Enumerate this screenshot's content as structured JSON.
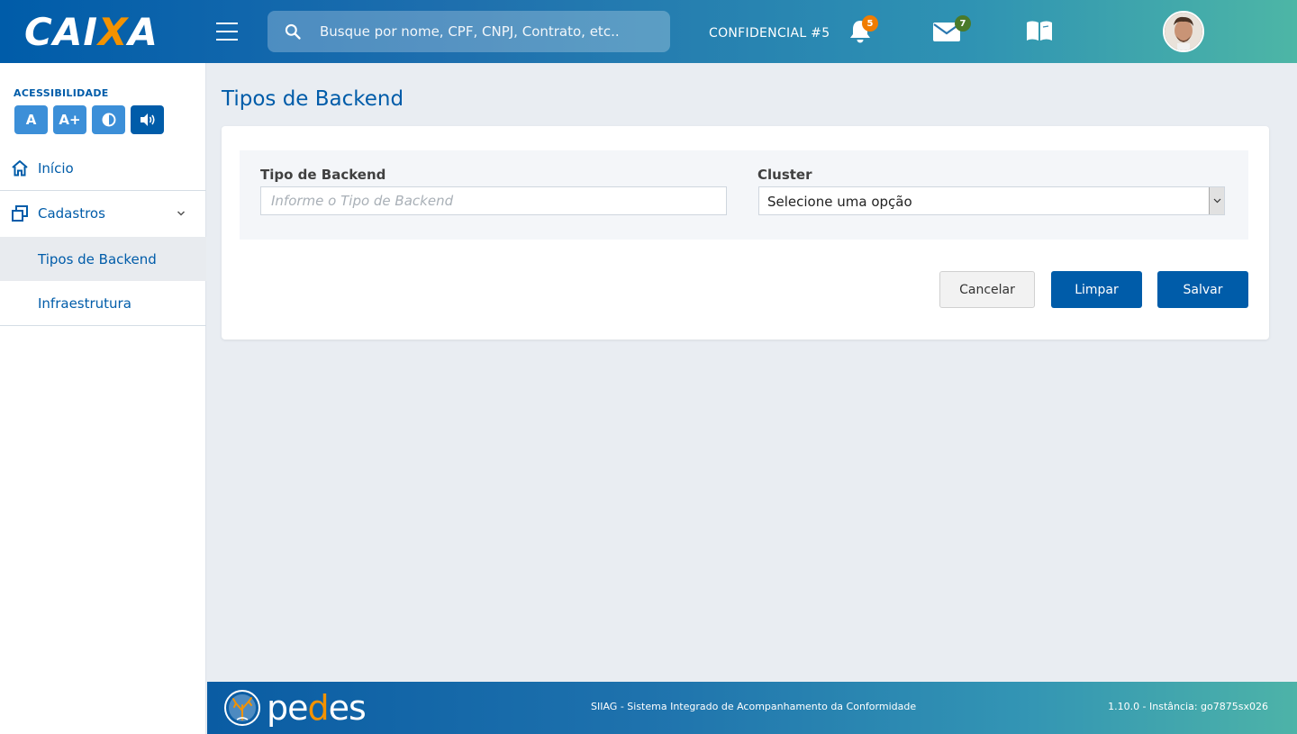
{
  "header": {
    "logo_prefix": "CAI",
    "logo_x": "X",
    "logo_suffix": "A",
    "search_placeholder": "Busque por nome, CPF, CNPJ, Contrato, etc..",
    "confidential_label": "CONFIDENCIAL #5",
    "notifications_count": "5",
    "messages_count": "7",
    "notification_badge_color": "#f07c00",
    "message_badge_color": "#4a7a2a",
    "icons": [
      "menu-icon",
      "search-icon",
      "bell-icon",
      "envelope-icon",
      "book-icon",
      "avatar"
    ]
  },
  "sidebar": {
    "accessibility_title": "ACESSIBILIDADE",
    "accessibility_buttons": [
      "A",
      "A+",
      "◐",
      "🔊"
    ],
    "items": [
      {
        "label": "Início",
        "icon": "home-icon"
      },
      {
        "label": "Cadastros",
        "icon": "layers-icon"
      },
      {
        "label": "Tipos de Backend"
      },
      {
        "label": "Infraestrutura"
      }
    ]
  },
  "main": {
    "page_title": "Tipos de Backend",
    "form": {
      "tipo_label": "Tipo de Backend",
      "tipo_placeholder": "Informe o Tipo de Backend",
      "tipo_value": "",
      "cluster_label": "Cluster",
      "cluster_selected": "Selecione uma opção"
    },
    "buttons": {
      "cancel": "Cancelar",
      "clear": "Limpar",
      "save": "Salvar"
    }
  },
  "footer": {
    "logo_p": "p",
    "logo_e1": "e",
    "logo_d": "d",
    "logo_e2": "e",
    "logo_s": "s",
    "system_name": "SIIAG  - Sistema Integrado de Acompanhamento da Conformidade",
    "version_info": "1.10.0 - Instância: go7875sx026"
  },
  "colors": {
    "brand_blue": "#005ca9",
    "accent_orange": "#f39200",
    "accessibility_blue": "#3c8fd8"
  }
}
